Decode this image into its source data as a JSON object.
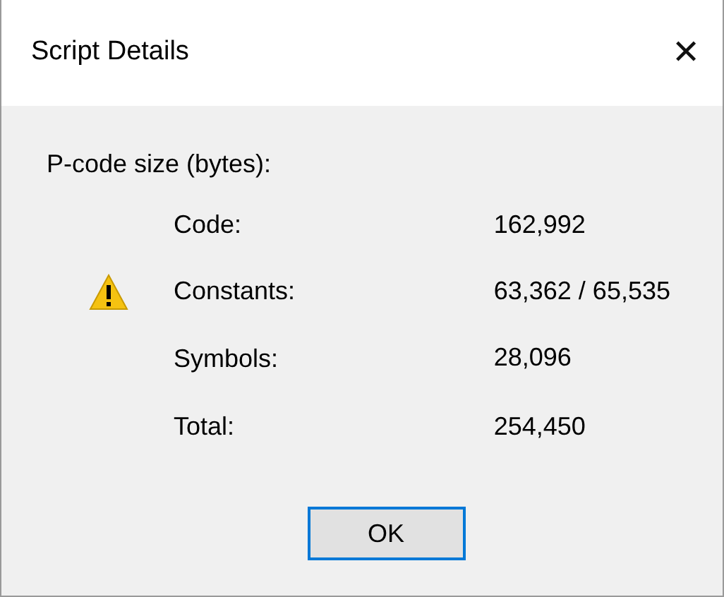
{
  "window": {
    "title": "Script Details",
    "close": "✕"
  },
  "section_label": "P-code size (bytes):",
  "rows": [
    {
      "label": "Code:",
      "value": "162,992",
      "warning": false
    },
    {
      "label": "Constants:",
      "value": "63,362 / 65,535",
      "warning": true
    },
    {
      "label": "Symbols:",
      "value": "28,096",
      "warning": false
    },
    {
      "label": "Total:",
      "value": "254,450",
      "warning": false
    }
  ],
  "buttons": [
    {
      "label": "OK",
      "focused": true
    }
  ]
}
